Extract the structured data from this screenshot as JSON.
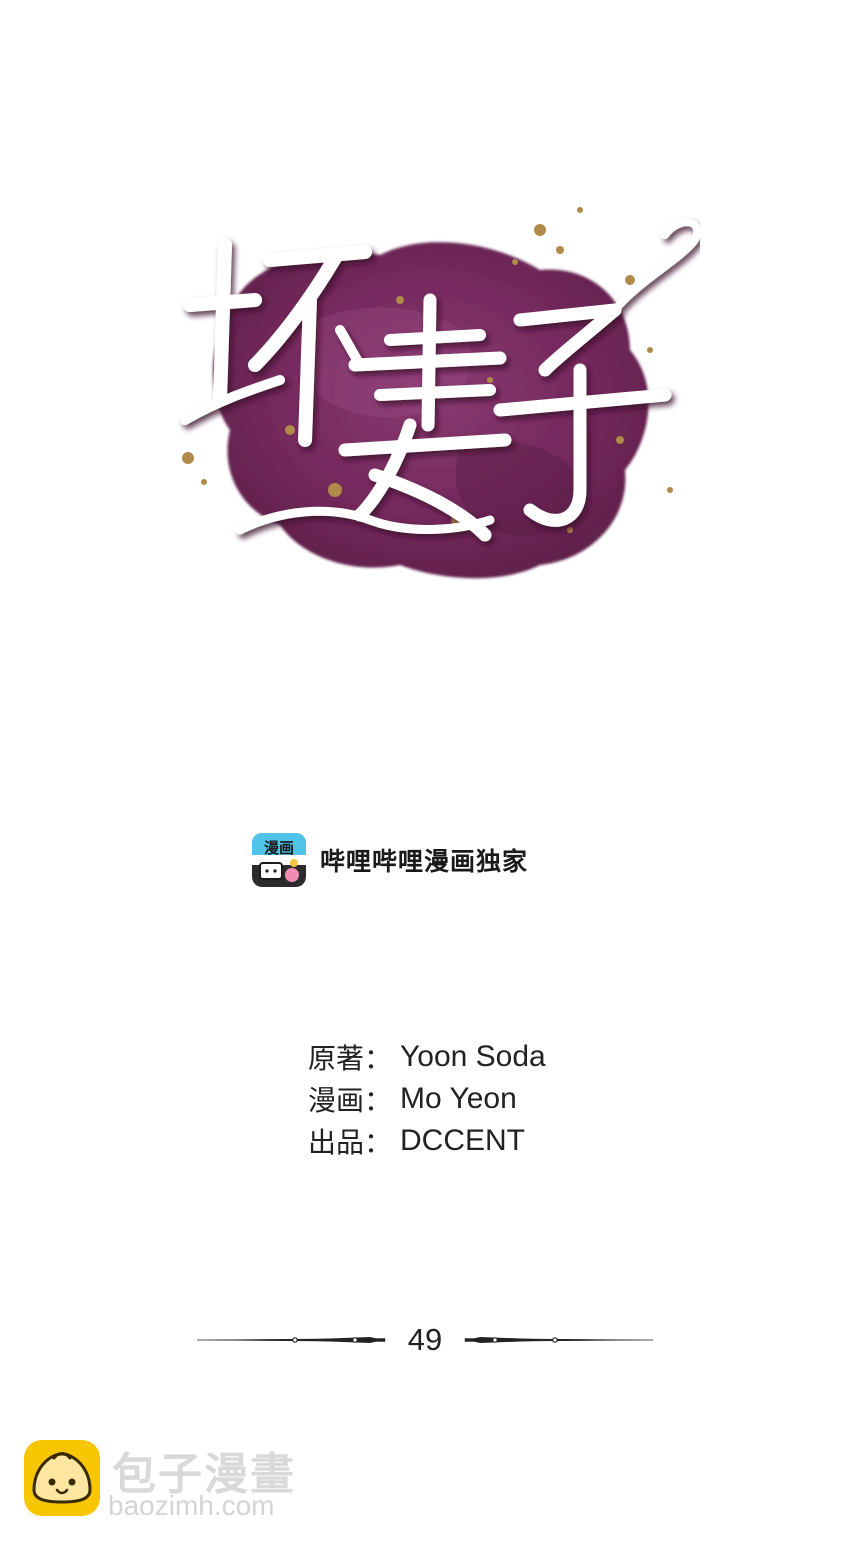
{
  "title_logo": {
    "text": "坏妻子",
    "colors": {
      "blot": "#7a2f62",
      "blot_dark": "#5e2049",
      "splatter": "#b08a4a",
      "lettering": "#ffffff",
      "lettering_shadow": "#4a1838"
    }
  },
  "platform": {
    "icon": "bilibili-manga-app-icon",
    "label": "哔哩哔哩漫画独家"
  },
  "credits": [
    {
      "label": "原著：",
      "value": "Yoon Soda"
    },
    {
      "label": "漫画：",
      "value": "Mo Yeon"
    },
    {
      "label": "出品：",
      "value": "DCCENT"
    }
  ],
  "chapter": {
    "number": "49"
  },
  "watermark": {
    "icon": "baozi-bun-icon",
    "title": "包子漫畫",
    "url": "baozimh.com",
    "colors": {
      "icon": "#f7c600",
      "text": "#d9d9d9"
    }
  }
}
